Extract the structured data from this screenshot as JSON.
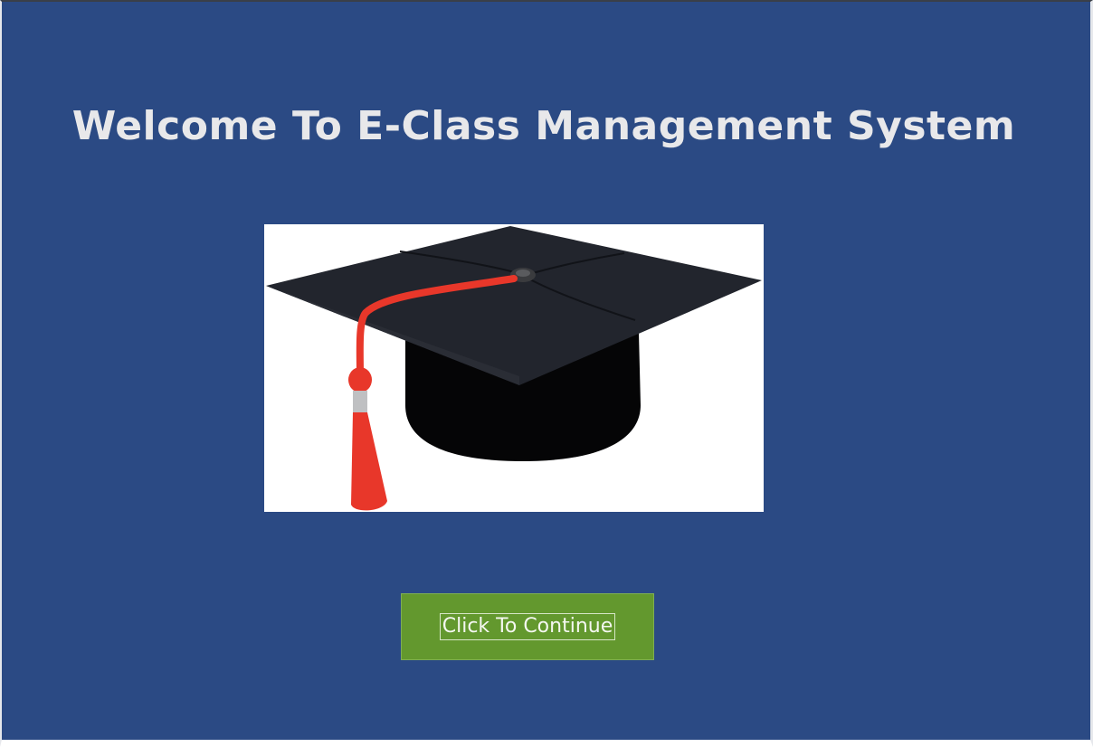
{
  "welcome": {
    "title": "Welcome To E-Class Management System"
  },
  "image": {
    "icon": "graduation-cap-icon"
  },
  "continue_button": {
    "label": "Click To Continue"
  },
  "colors": {
    "background": "#2b4a84",
    "title_text": "#e8e8ea",
    "button_bg": "#63982e",
    "button_text": "#f4f7f0",
    "tassel": "#e8372a",
    "cap": "#22252d"
  }
}
